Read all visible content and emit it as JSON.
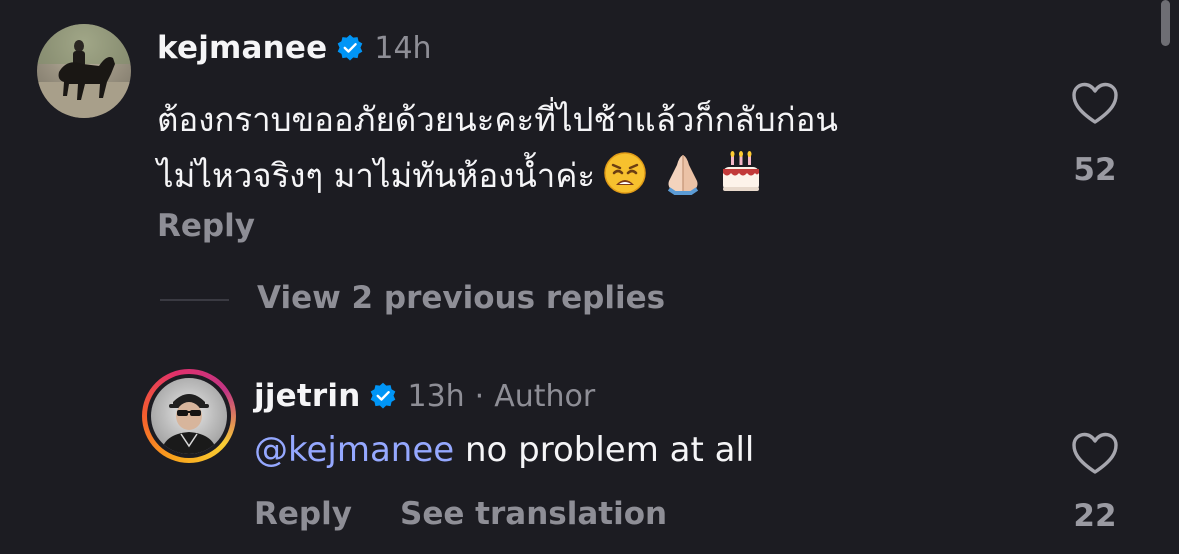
{
  "comments": [
    {
      "username": "kejmanee",
      "verified": true,
      "time": "14h",
      "text_lines": [
        "ต้องกราบขออภัยด้วยนะคะที่ไปช้าแล้วก็กลับก่อน",
        "ไม่ไหวจริงๆ  มาไม่ทันห้องน้ำค่ะ"
      ],
      "emojis": [
        "weary-face",
        "folded-hands",
        "birthday-cake"
      ],
      "likes": "52",
      "reply_label": "Reply"
    }
  ],
  "view_replies_label": "View 2 previous replies",
  "reply": {
    "username": "jjetrin",
    "verified": true,
    "time": "13h",
    "separator": "·",
    "author_label": "Author",
    "mention": "@kejmanee",
    "text": " no problem at all",
    "likes": "22",
    "reply_label": "Reply",
    "translation_label": "See translation"
  },
  "colors": {
    "background": "#1c1c22",
    "verified_blue": "#0095f6",
    "mention": "#95a8ff",
    "secondary_text": "#8e8e96"
  }
}
